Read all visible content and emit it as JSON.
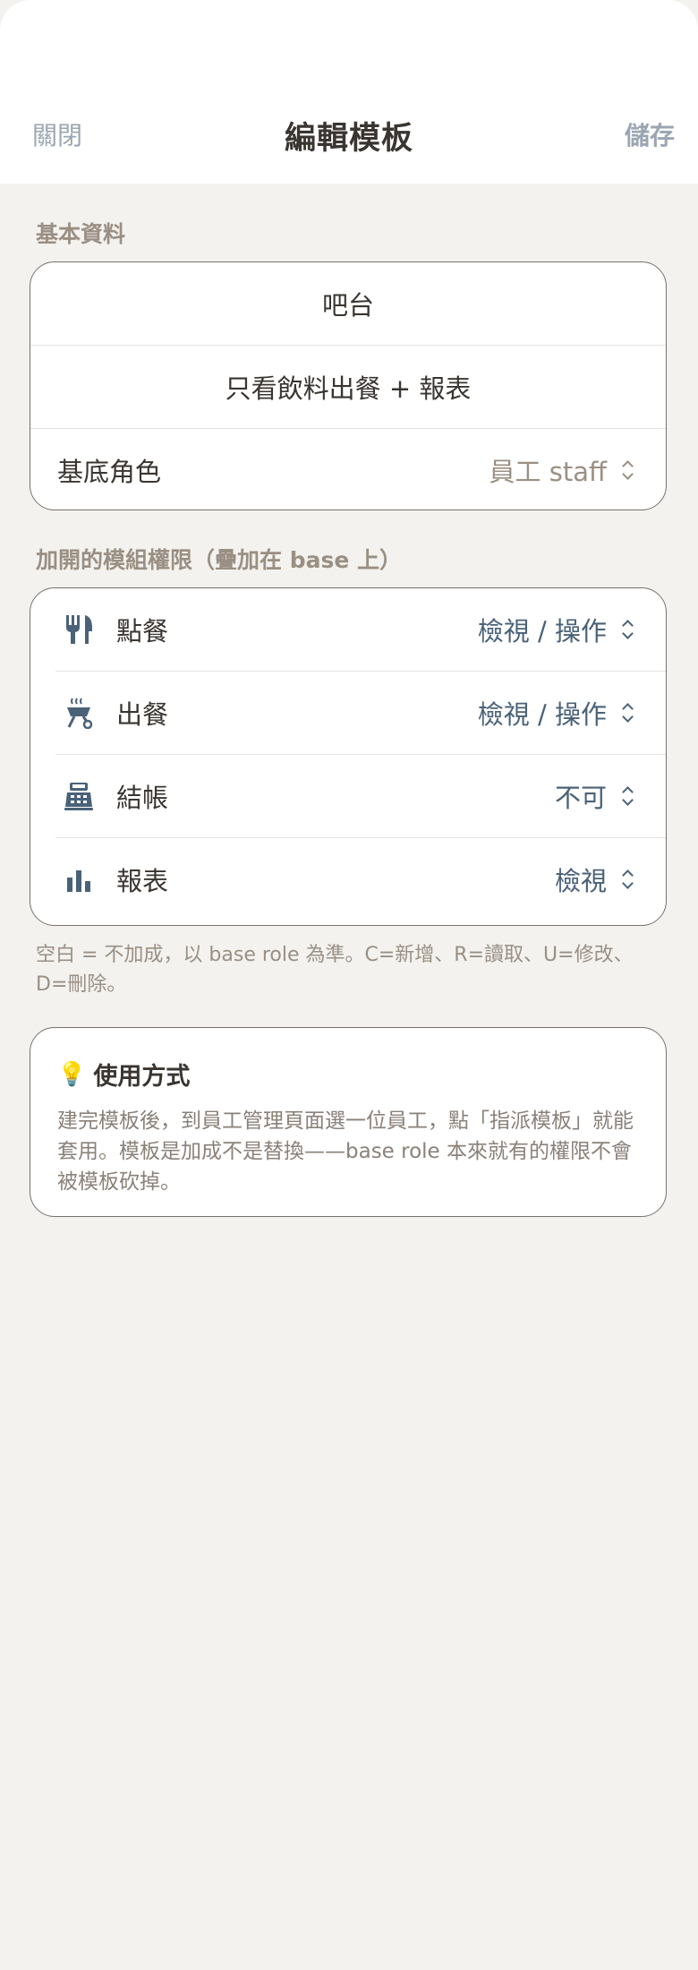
{
  "nav": {
    "close_label": "關閉",
    "title": "編輯模板",
    "save_label": "儲存"
  },
  "basic": {
    "section_label": "基本資料",
    "name_value": "吧台",
    "description_value": "只看飲料出餐 + 報表",
    "base_role_label": "基底角色",
    "base_role_value": "員工 staff"
  },
  "permissions": {
    "section_label": "加開的模組權限（疊加在 base 上）",
    "items": [
      {
        "label": "點餐",
        "value": "檢視 / 操作",
        "icon": "utensils-icon"
      },
      {
        "label": "出餐",
        "value": "檢視 / 操作",
        "icon": "serving-cart-icon"
      },
      {
        "label": "結帳",
        "value": "不可",
        "icon": "cash-register-icon"
      },
      {
        "label": "報表",
        "value": "檢視",
        "icon": "bar-chart-icon"
      }
    ]
  },
  "note": "空白 = 不加成，以 base role 為準。C=新增、R=讀取、U=修改、D=刪除。",
  "tip": {
    "icon": "lightbulb-icon",
    "bulb_glyph": "💡",
    "title": "使用方式",
    "body": "建完模板後，到員工管理頁面選一位員工，點「指派模板」就能套用。模板是加成不是替換——base role 本來就有的權限不會被模板砍掉。"
  },
  "colors": {
    "background": "#f3f2ef",
    "card": "#ffffff",
    "muted_label": "#9a8f83",
    "accent_value": "#4a6278",
    "nav_action": "#9aa6b2",
    "icon": "#4a6278"
  }
}
